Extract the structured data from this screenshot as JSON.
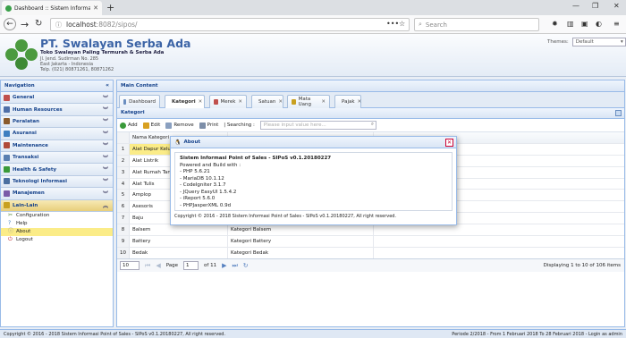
{
  "browser": {
    "tab_title": "Dashboard :: Sistem Informasi",
    "url_host": "localhost",
    "url_rest": ":8082/sipos/",
    "search_placeholder": "Search"
  },
  "header": {
    "company": "PT. Swalayan Serba Ada",
    "tagline": "Toko Swalayan Paling Termurah & Serba Ada",
    "address1": "Jl. Jend. Sudirman No. 285",
    "address2": "East Jakarta - Indonesia",
    "phone": "Telp. (021) 80871261, 80871262",
    "themes_label": "Themes:",
    "themes_value": "Default"
  },
  "sidebar": {
    "title": "Navigation",
    "sections": [
      {
        "label": "General",
        "color": "#c0504d"
      },
      {
        "label": "Human Resources",
        "color": "#4f6fa8"
      },
      {
        "label": "Peralatan",
        "color": "#8a5a2b"
      },
      {
        "label": "Asuransi",
        "color": "#3f7fc0"
      },
      {
        "label": "Maintenance",
        "color": "#b04a3a"
      },
      {
        "label": "Transaksi",
        "color": "#5a7fb0"
      },
      {
        "label": "Health & Safety",
        "color": "#3a9a3a"
      },
      {
        "label": "Teknologi Informasi",
        "color": "#4a6fa0"
      },
      {
        "label": "Manajemen",
        "color": "#7a5aa8"
      },
      {
        "label": "Lain-Lain",
        "color": "#c8a020"
      }
    ],
    "subitems": [
      {
        "label": "Configuration"
      },
      {
        "label": "Help"
      },
      {
        "label": "About"
      },
      {
        "label": "Logout"
      }
    ]
  },
  "main": {
    "title": "Main Content",
    "tabs": [
      {
        "label": "Dashboard"
      },
      {
        "label": "Kategori"
      },
      {
        "label": "Merek"
      },
      {
        "label": "Satuan"
      },
      {
        "label": "Mata Uang"
      },
      {
        "label": "Pajak"
      }
    ],
    "panel_title": "Kategori",
    "toolbar": {
      "add": "Add",
      "edit": "Edit",
      "remove": "Remove",
      "print": "Print",
      "searching": "| Searching :",
      "search_placeholder": "Please input value here..."
    },
    "grid": {
      "header": "Nama Kategori",
      "rows": [
        {
          "n": "1",
          "a": "Alat Dapur Keluar",
          "b": ""
        },
        {
          "n": "2",
          "a": "Alat Listrik",
          "b": ""
        },
        {
          "n": "3",
          "a": "Alat Rumah Tangga",
          "b": ""
        },
        {
          "n": "4",
          "a": "Alat Tulis",
          "b": ""
        },
        {
          "n": "5",
          "a": "Amplop",
          "b": ""
        },
        {
          "n": "6",
          "a": "Asesoris",
          "b": ""
        },
        {
          "n": "7",
          "a": "Baju",
          "b": ""
        },
        {
          "n": "8",
          "a": "Balsem",
          "b": "Kategori Balsem"
        },
        {
          "n": "9",
          "a": "Battery",
          "b": "Kategori Battery"
        },
        {
          "n": "10",
          "a": "Bedak",
          "b": "Kategori Bedak"
        }
      ]
    },
    "pager": {
      "page_size": "10",
      "page_label": "Page",
      "page_value": "1",
      "of_label": "of 11",
      "info": "Displaying 1 to 10 of 106 items"
    }
  },
  "dialog": {
    "title": "About",
    "heading": "Sistem Informasi Point of Sales - SIPoS v0.1.20180227",
    "lines": [
      "Powered and Build with :",
      "- PHP 5.6.21",
      "- MariaDB 10.1.12",
      "- CodeIgniter 3.1.7",
      "- JQuery EasyUI 1.5.4.2",
      "- iReport 5.6.0",
      "- PHPJasperXML 0.9d"
    ],
    "footer": "Copyright © 2016 - 2018 Sistem Informasi Point of Sales - SIPoS v0.1.20180227, All right reserved."
  },
  "footer": {
    "left": "Copyright © 2016 - 2018 Sistem Informasi Point of Sales - SIPoS v0.1.20180227, All right reserved.",
    "right": "Periode 2/2018 - From 1 Februari 2018 To 28 Februari 2018 - Login as admin"
  }
}
